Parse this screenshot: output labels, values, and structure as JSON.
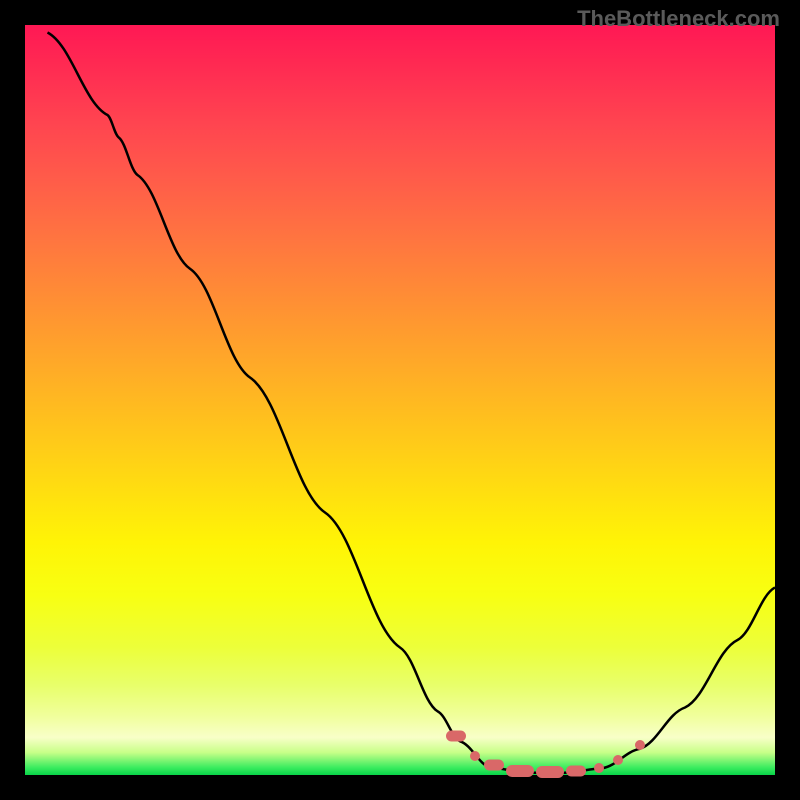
{
  "watermark": "TheBottleneck.com",
  "chart_data": {
    "type": "line",
    "title": "",
    "xlabel": "",
    "ylabel": "",
    "xlim": [
      0,
      100
    ],
    "ylim": [
      0,
      100
    ],
    "curve_points": [
      {
        "x": 3,
        "y": 99
      },
      {
        "x": 11,
        "y": 88
      },
      {
        "x": 12.5,
        "y": 85
      },
      {
        "x": 15,
        "y": 80
      },
      {
        "x": 22,
        "y": 67.5
      },
      {
        "x": 30,
        "y": 53
      },
      {
        "x": 40,
        "y": 35
      },
      {
        "x": 50,
        "y": 17
      },
      {
        "x": 55,
        "y": 8.5
      },
      {
        "x": 58,
        "y": 4.5
      },
      {
        "x": 62,
        "y": 1.0
      },
      {
        "x": 67,
        "y": 0.3
      },
      {
        "x": 72,
        "y": 0.3
      },
      {
        "x": 77,
        "y": 0.9
      },
      {
        "x": 82,
        "y": 3.5
      },
      {
        "x": 88,
        "y": 9
      },
      {
        "x": 95,
        "y": 18
      },
      {
        "x": 100,
        "y": 25
      }
    ],
    "markers": [
      {
        "x": 57.5,
        "y": 5.2,
        "shape": "capsule-sm"
      },
      {
        "x": 60,
        "y": 2.5,
        "shape": "dot"
      },
      {
        "x": 62.5,
        "y": 1.3,
        "shape": "capsule-sm"
      },
      {
        "x": 66,
        "y": 0.6,
        "shape": "capsule"
      },
      {
        "x": 70,
        "y": 0.4,
        "shape": "capsule"
      },
      {
        "x": 73.5,
        "y": 0.5,
        "shape": "capsule-sm"
      },
      {
        "x": 76.5,
        "y": 1.0,
        "shape": "dot"
      },
      {
        "x": 79,
        "y": 2.0,
        "shape": "dot"
      },
      {
        "x": 82,
        "y": 4.0,
        "shape": "dot"
      }
    ],
    "marker_color": "#d96868"
  }
}
